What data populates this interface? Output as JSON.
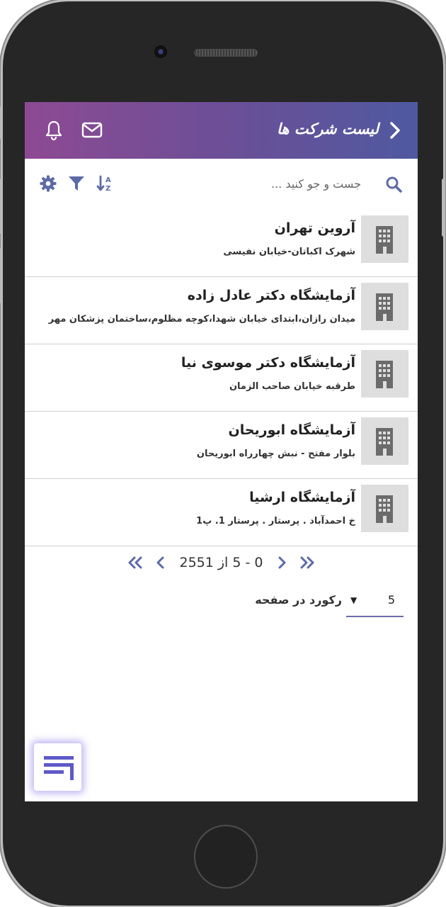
{
  "colors": {
    "header_start": "#8d4a93",
    "header_end": "#4f59a0",
    "accent": "#5d6aa8",
    "thumb_bg": "#dedede"
  },
  "header": {
    "title": "لیست شرکت ها",
    "back_icon": "chevron-right-icon",
    "mail_icon": "mail-icon",
    "bell_icon": "bell-icon"
  },
  "search": {
    "placeholder": "جست و جو کنید ...",
    "value": "",
    "search_icon": "search-icon"
  },
  "toolbar": {
    "sort_icon": "sort-az-icon",
    "filter_icon": "filter-icon",
    "settings_icon": "gear-icon"
  },
  "companies": [
    {
      "name": "آروین تهران",
      "address": "شهرک اکباتان-خیابان نفیسی",
      "icon": "building-icon"
    },
    {
      "name": "آزمایشگاه دکتر عادل زاده",
      "address": "میدان رازان،ابتدای خیابان شهدا،کوچه مظلوم،ساختمان پزشکان مهر",
      "icon": "building-icon"
    },
    {
      "name": "آزمایشگاه دکتر موسوی نیا",
      "address": "طرقبه خیابان صاحب الزمان",
      "icon": "building-icon"
    },
    {
      "name": "آزمایشگاه ابوریحان",
      "address": "بلوار مفتح - نبش چهارراه ابوریحان",
      "icon": "building-icon"
    },
    {
      "name": "آزمایشگاه ارشیا",
      "address": "خ احمدآباد . پرستار . پرستار 1. پ1",
      "icon": "building-icon"
    }
  ],
  "pagination": {
    "range_text": "0 - 5 از 2551",
    "first_icon": "double-chevron-right-icon",
    "prev_icon": "chevron-right-icon",
    "next_icon": "chevron-left-icon",
    "last_icon": "double-chevron-left-icon"
  },
  "records_per_page": {
    "label": "رکورد در صفحه",
    "selected": "5",
    "dropdown_icon": "caret-down-icon"
  },
  "fab": {
    "icon": "menu-lines-icon"
  }
}
